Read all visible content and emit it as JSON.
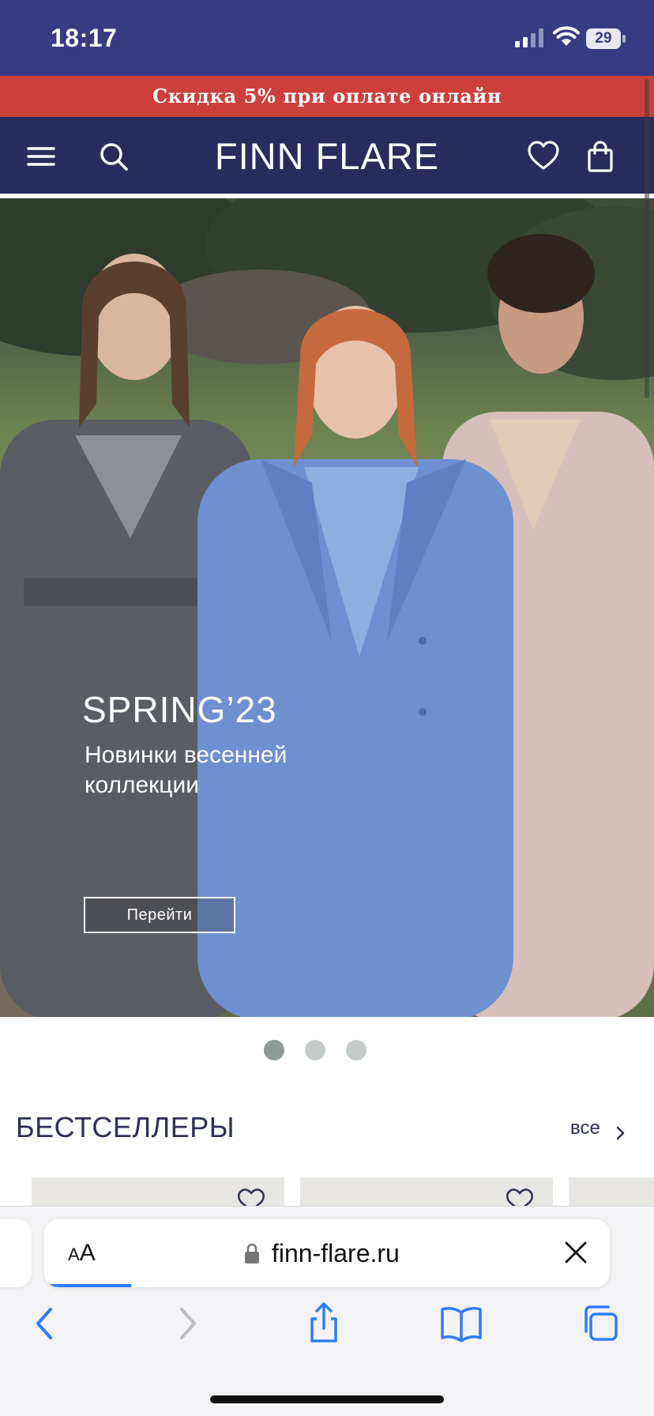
{
  "status_bar": {
    "time": "18:17",
    "battery_level": "29",
    "icons": [
      "signal-icon",
      "wifi-icon",
      "battery-icon"
    ]
  },
  "promo": {
    "text": "Скидка 5% при оплате онлайн",
    "color": "#cc3f3c"
  },
  "header": {
    "logo": "FINN FLARE",
    "icons": [
      "menu-icon",
      "search-icon",
      "heart-icon",
      "shopping-bag-icon"
    ],
    "color": "#292b5c"
  },
  "hero": {
    "title": "SPRING’23",
    "subtitle": "Новинки весенней коллекции",
    "button_label": "Перейти"
  },
  "carousel": {
    "count": 3,
    "active_index": 0
  },
  "bestsellers": {
    "title": "БЕСТСЕЛЛЕРЫ",
    "link_label": "все"
  },
  "browser": {
    "text_size_label_small": "A",
    "text_size_label_large": "A",
    "url": "finn-flare.ru",
    "toolbar_icons": [
      "back-icon",
      "forward-icon",
      "share-icon",
      "bookmarks-icon",
      "tabs-icon"
    ],
    "accent": "#2f7cf6"
  }
}
